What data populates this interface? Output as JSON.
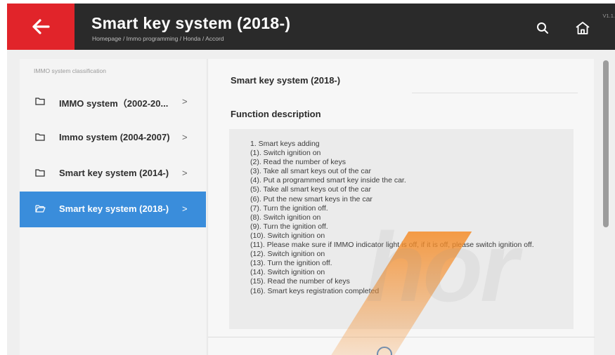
{
  "header": {
    "title": "Smart key system (2018-)",
    "breadcrumb": "Homepage / Immo programming / Honda / Accord",
    "version": "V1.1.",
    "back_icon": "back-arrow-icon",
    "search_icon": "search-icon",
    "home_icon": "home-icon",
    "accent_color": "#e1242a"
  },
  "sidebar": {
    "heading": "IMMO system classification",
    "items": [
      {
        "label": "IMMO system（2002-20...",
        "icon": "folder-icon",
        "chevron": ">"
      },
      {
        "label": "Immo system (2004-2007)",
        "icon": "folder-icon",
        "chevron": ">"
      },
      {
        "label": "Smart key system (2014-)",
        "icon": "folder-icon",
        "chevron": ">"
      },
      {
        "label": "Smart key system (2018-)",
        "icon": "folder-open-icon",
        "chevron": ">",
        "active": true
      }
    ],
    "active_color": "#3a8ddb"
  },
  "content": {
    "title": "Smart key system (2018-)",
    "subtitle": "Function description",
    "lines": [
      "1. Smart keys adding",
      "(1). Switch ignition on",
      "(2). Read the number of keys",
      "(3). Take all smart keys out of the car",
      "(4). Put a programmed smart key inside the car.",
      "(5). Take all smart keys out of the car",
      "(6). Put the new smart keys in the car",
      "(7). Turn the ignition off.",
      "(8). Switch ignition on",
      "(9). Turn the ignition off.",
      "(10). Switch ignition on",
      "(11). Please make sure if IMMO indicator light is off, if it is off, please switch ignition off.",
      "(12). Switch ignition on",
      "(13). Turn the ignition off.",
      "(14). Switch ignition on",
      "(15). Read the number of keys",
      "(16). Smart keys registration completed"
    ]
  }
}
